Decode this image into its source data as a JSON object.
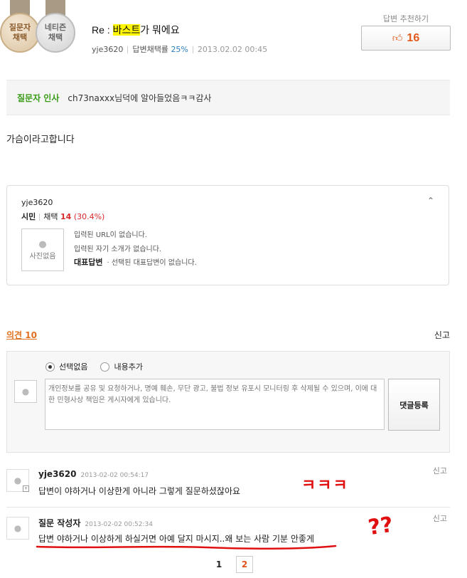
{
  "badges": [
    {
      "line1": "질문자",
      "line2": "채택"
    },
    {
      "line1": "네티즌",
      "line2": "채택"
    }
  ],
  "answer": {
    "title_prefix": "Re : ",
    "title_highlight": "바스트",
    "title_suffix": "가 뭐에요",
    "author": "yje3620",
    "adopt_rate_label": "답변채택률",
    "adopt_rate": "25%",
    "date": "2013.02.02 00:45",
    "body": "가슴이라고합니다"
  },
  "recommend": {
    "label": "답변 추천하기",
    "count": "16"
  },
  "greeting": {
    "label": "질문자 인사",
    "text": "ch73naxxx님덕에 알아들었음ㅋㅋ감사"
  },
  "profile": {
    "user_id": "yje3620",
    "grade": "시민",
    "adopt_label": "채택",
    "adopt_count": "14",
    "adopt_pct": "(30.4%)",
    "photo_text": "사진없음",
    "url_text": "입력된 URL이 없습니다.",
    "intro_text": "입력된 자기 소개가 없습니다.",
    "rep_label": "대표답변",
    "rep_text": "· 선택된 대표답변이 없습니다."
  },
  "opinions": {
    "label": "의견",
    "count": "10",
    "report_label": "신고",
    "radio_options": [
      "선택없음",
      "내용추가"
    ],
    "placeholder": "개인정보를 공유 및 요청하거나, 명예 훼손, 무단 광고, 불법 정보 유포시 모니터링 후 삭제될 수 있으며, 이에 대한 민형사상 책임은 게시자에게 있습니다.",
    "submit_label": "댓글등록"
  },
  "comments": [
    {
      "author": "yje3620",
      "date": "2013-02-02 00:54:17",
      "text": "답변이 야하거나 이상한게 아니라 그렇게 질문하셨잖아요",
      "report": "신고"
    },
    {
      "author": "질문 작성자",
      "date": "2013-02-02 00:52:34",
      "text": "답변 야하거나 이상하게 하실거면 아예 달지 마시지..왜 보는 사람 기분 안좋게",
      "report": "신고"
    }
  ],
  "pagination": [
    "1",
    "2"
  ],
  "annotations": {
    "laugh": "ㅋㅋㅋ",
    "question": "??"
  }
}
